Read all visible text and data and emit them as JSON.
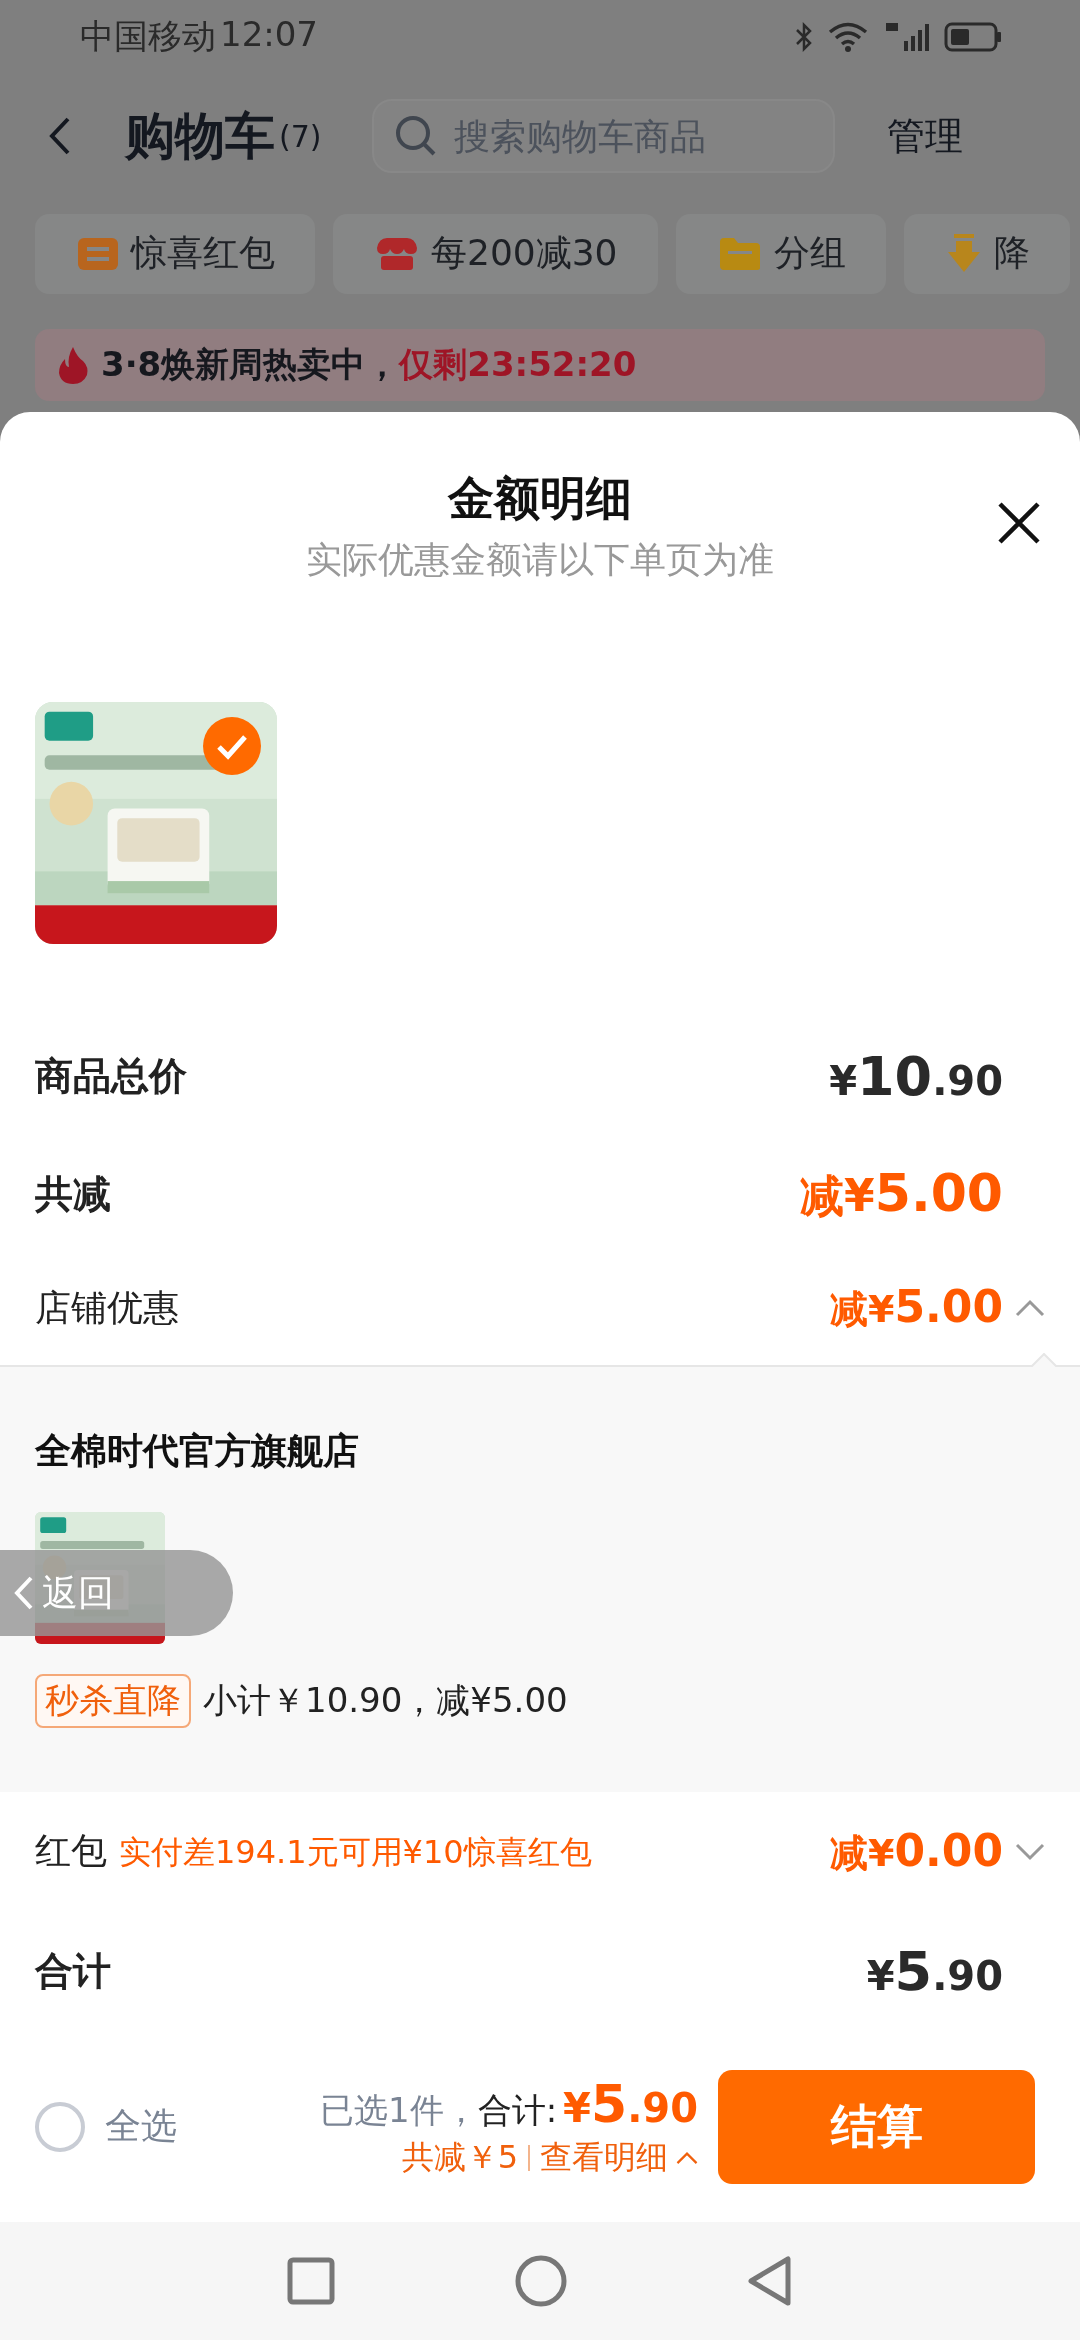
{
  "status_bar": {
    "carrier": "中国移动",
    "time": "12:07"
  },
  "header": {
    "title": "购物车",
    "count": "(7)",
    "search": {
      "placeholder": "搜索购物车商品"
    },
    "action": "管理"
  },
  "chips": [
    {
      "kind": "coupon",
      "label": "惊喜红包"
    },
    {
      "kind": "shop",
      "label": "每200减30"
    },
    {
      "kind": "folder",
      "label": "分组"
    },
    {
      "kind": "price-drop",
      "label": "降"
    }
  ],
  "banner": {
    "text": "3·8焕新周热卖中，",
    "countdown": "仅剩23:52:20"
  },
  "sheet": {
    "title": "金额明细",
    "subtitle": "实际优惠金额请以下单页为准",
    "product": {
      "kind": "picture",
      "checked": true
    },
    "goods_total": {
      "label": "商品总价",
      "amount": "¥10.90"
    },
    "total_discount": {
      "label": "共减",
      "amount": "减¥5.00"
    },
    "store_discount": {
      "label": "店铺优惠",
      "amount": "减¥5.00",
      "expanded": true
    },
    "store_detail": {
      "name": "全棉时代官方旗舰店",
      "product": {
        "kind": "picture"
      },
      "tag": "秒杀直降",
      "summary": "小计￥10.90，减¥5.00"
    },
    "red_packet": {
      "label": "红包",
      "hint": "实付差194.1元可用¥10惊喜红包",
      "amount": "减¥0.00",
      "expanded": false
    },
    "grand_total": {
      "label": "合计",
      "amount": "¥5.90"
    }
  },
  "footer": {
    "select_all": {
      "label": "全选",
      "checked": false
    },
    "selected": "已选1件，",
    "total_label": "合计:",
    "total": "¥5.90",
    "saved": "共减￥5",
    "details_link": "查看明细",
    "details_expanded": true,
    "checkout": "结算"
  },
  "back_overlay": {
    "label": "返回"
  }
}
